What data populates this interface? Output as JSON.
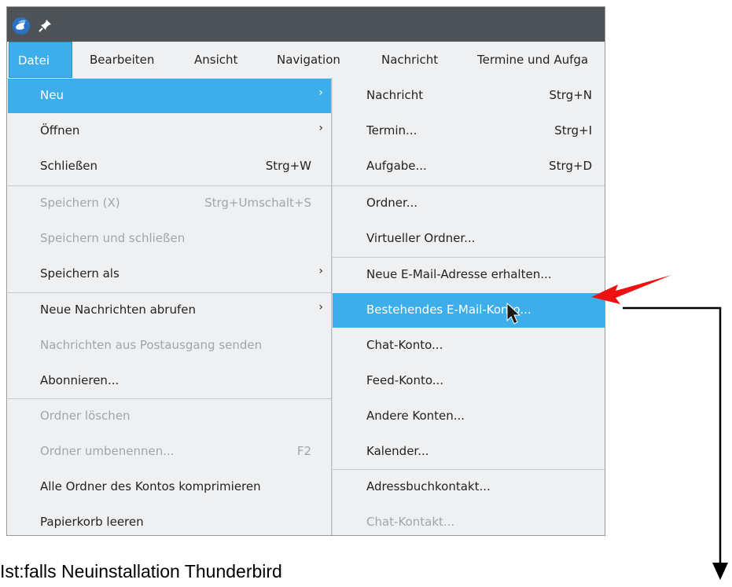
{
  "titlebar": {
    "icons": [
      "thunderbird-logo",
      "pin-icon"
    ]
  },
  "menubar": {
    "items": [
      {
        "label": "Datei",
        "active": true
      },
      {
        "label": "Bearbeiten"
      },
      {
        "label": "Ansicht"
      },
      {
        "label": "Navigation"
      },
      {
        "label": "Nachricht"
      },
      {
        "label": "Termine und Aufga"
      }
    ]
  },
  "file_menu": {
    "items": [
      {
        "label": "Neu",
        "arrow": "›",
        "highlighted": true
      },
      {
        "label": "Öffnen",
        "arrow": "›"
      },
      {
        "label": "Schließen",
        "shortcut": "Strg+W"
      },
      {
        "label": "Speichern (X)",
        "shortcut": "Strg+Umschalt+S",
        "disabled": true
      },
      {
        "label": "Speichern und schließen",
        "disabled": true
      },
      {
        "label": "Speichern als",
        "arrow": "›"
      },
      {
        "label": "Neue Nachrichten abrufen",
        "arrow": "›"
      },
      {
        "label": "Nachrichten aus Postausgang senden",
        "disabled": true
      },
      {
        "label": "Abonnieren..."
      },
      {
        "label": "Ordner löschen",
        "disabled": true
      },
      {
        "label": "Ordner umbenennen...",
        "shortcut": "F2",
        "disabled": true
      },
      {
        "label": "Alle Ordner des Kontos komprimieren"
      },
      {
        "label": "Papierkorb leeren"
      }
    ]
  },
  "new_submenu": {
    "items": [
      {
        "label": "Nachricht",
        "shortcut": "Strg+N"
      },
      {
        "label": "Termin...",
        "shortcut": "Strg+I"
      },
      {
        "label": "Aufgabe...",
        "shortcut": "Strg+D"
      },
      {
        "label": "Ordner..."
      },
      {
        "label": "Virtueller Ordner..."
      },
      {
        "label": "Neue E-Mail-Adresse erhalten..."
      },
      {
        "label": "Bestehendes E-Mail-Konto...",
        "highlighted": true
      },
      {
        "label": "Chat-Konto..."
      },
      {
        "label": "Feed-Konto..."
      },
      {
        "label": "Andere Konten..."
      },
      {
        "label": "Kalender..."
      },
      {
        "label": "Adressbuchkontakt..."
      },
      {
        "label": "Chat-Kontakt...",
        "disabled": true
      }
    ]
  },
  "annotation": {
    "arrow_color": "#ee1111",
    "line_color": "#000000"
  },
  "caption": "Ist:falls Neuinstallation Thunderbird"
}
